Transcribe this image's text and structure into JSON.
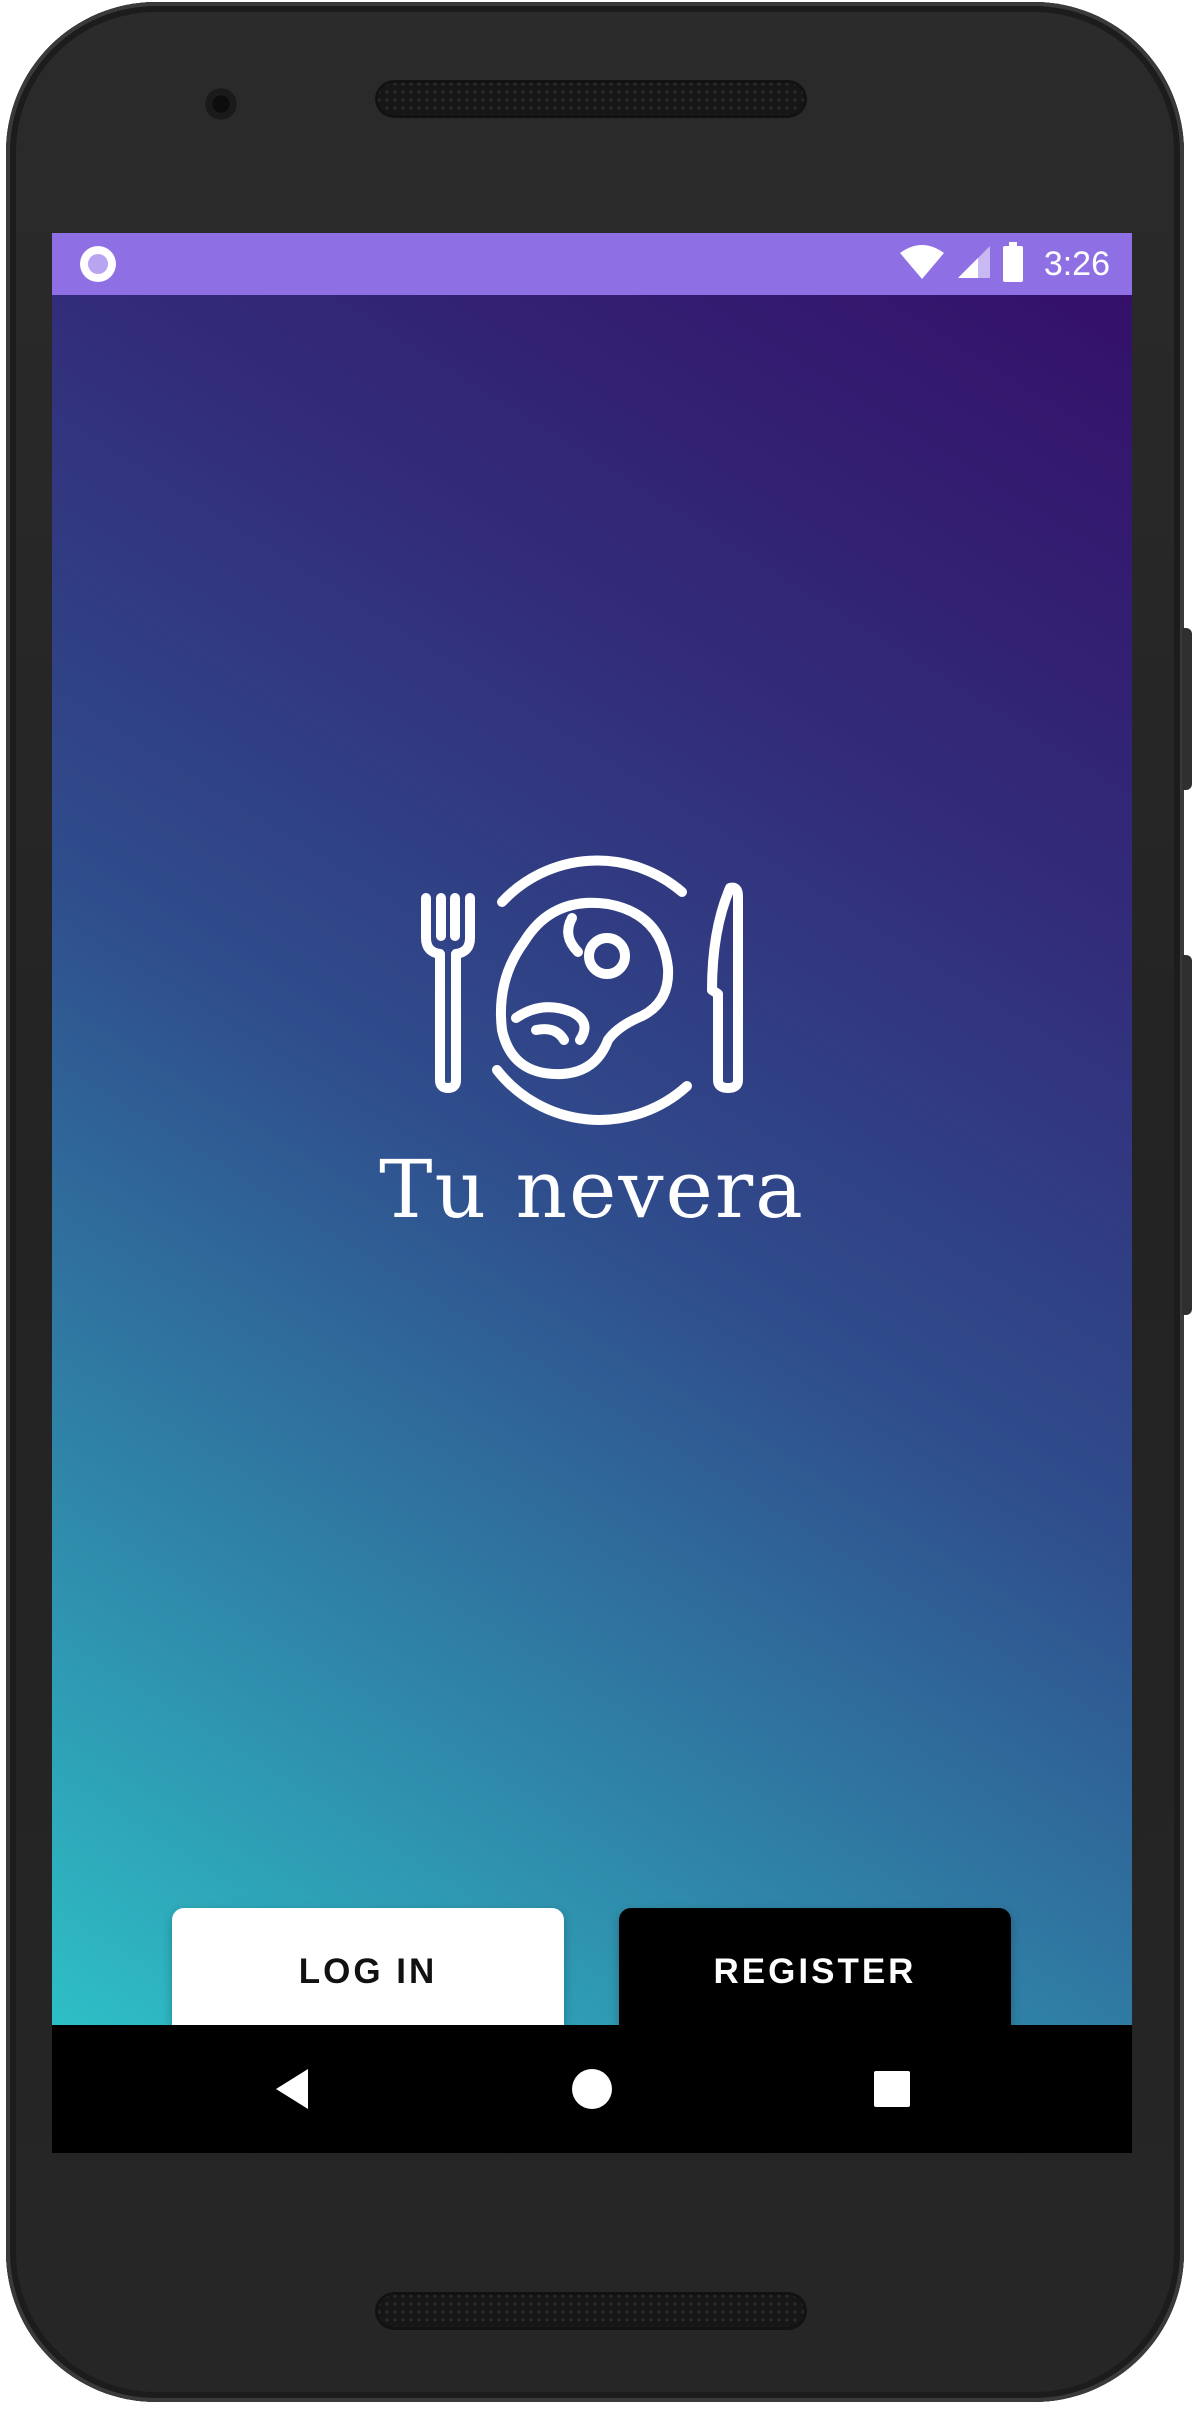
{
  "status_bar": {
    "time": "3:26",
    "background_color": "#8f6fe4",
    "icons": [
      "notification-dot-icon",
      "wifi-icon",
      "cell-signal-icon",
      "battery-icon"
    ]
  },
  "app": {
    "logo_icon": "plate-with-steak-fork-knife-icon",
    "title": "Tu nevera",
    "gradient_colors": [
      "#34106a",
      "#2f4d8c",
      "#2ebfc6"
    ]
  },
  "buttons": {
    "login_label": "LOG IN",
    "register_label": "REGISTER"
  },
  "nav_bar": {
    "icons": [
      "back-icon",
      "home-icon",
      "recents-icon"
    ]
  }
}
